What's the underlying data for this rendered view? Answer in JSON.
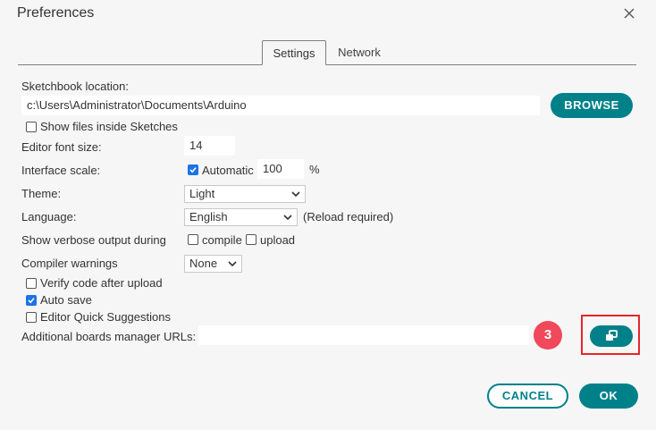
{
  "window": {
    "title": "Preferences"
  },
  "tabs": [
    {
      "label": "Settings",
      "active": true
    },
    {
      "label": "Network",
      "active": false
    }
  ],
  "settings": {
    "sketchbook_label": "Sketchbook location:",
    "sketchbook_value": "c:\\Users\\Administrator\\Documents\\Arduino",
    "browse_label": "BROWSE",
    "show_files_label": "Show files inside Sketches",
    "show_files_checked": false,
    "font_size_label": "Editor font size:",
    "font_size_value": "14",
    "scale_label": "Interface scale:",
    "scale_auto_label": "Automatic",
    "scale_auto_checked": true,
    "scale_value": "100",
    "scale_unit": "%",
    "theme_label": "Theme:",
    "theme_value": "Light",
    "language_label": "Language:",
    "language_value": "English",
    "language_note": "(Reload required)",
    "verbose_label": "Show verbose output during",
    "verbose_compile_label": "compile",
    "verbose_compile_checked": false,
    "verbose_upload_label": "upload",
    "verbose_upload_checked": false,
    "warnings_label": "Compiler warnings",
    "warnings_value": "None",
    "verify_label": "Verify code after upload",
    "verify_checked": false,
    "autosave_label": "Auto save",
    "autosave_checked": true,
    "quick_suggest_label": "Editor Quick Suggestions",
    "quick_suggest_checked": false,
    "boards_url_label": "Additional boards manager URLs:",
    "boards_url_value": ""
  },
  "annotation": {
    "step_number": "3"
  },
  "footer": {
    "cancel_label": "CANCEL",
    "ok_label": "OK"
  },
  "colors": {
    "accent": "#00818a",
    "badge": "#f1485b",
    "highlight": "#e5262b",
    "checkbox": "#1a73e8"
  }
}
